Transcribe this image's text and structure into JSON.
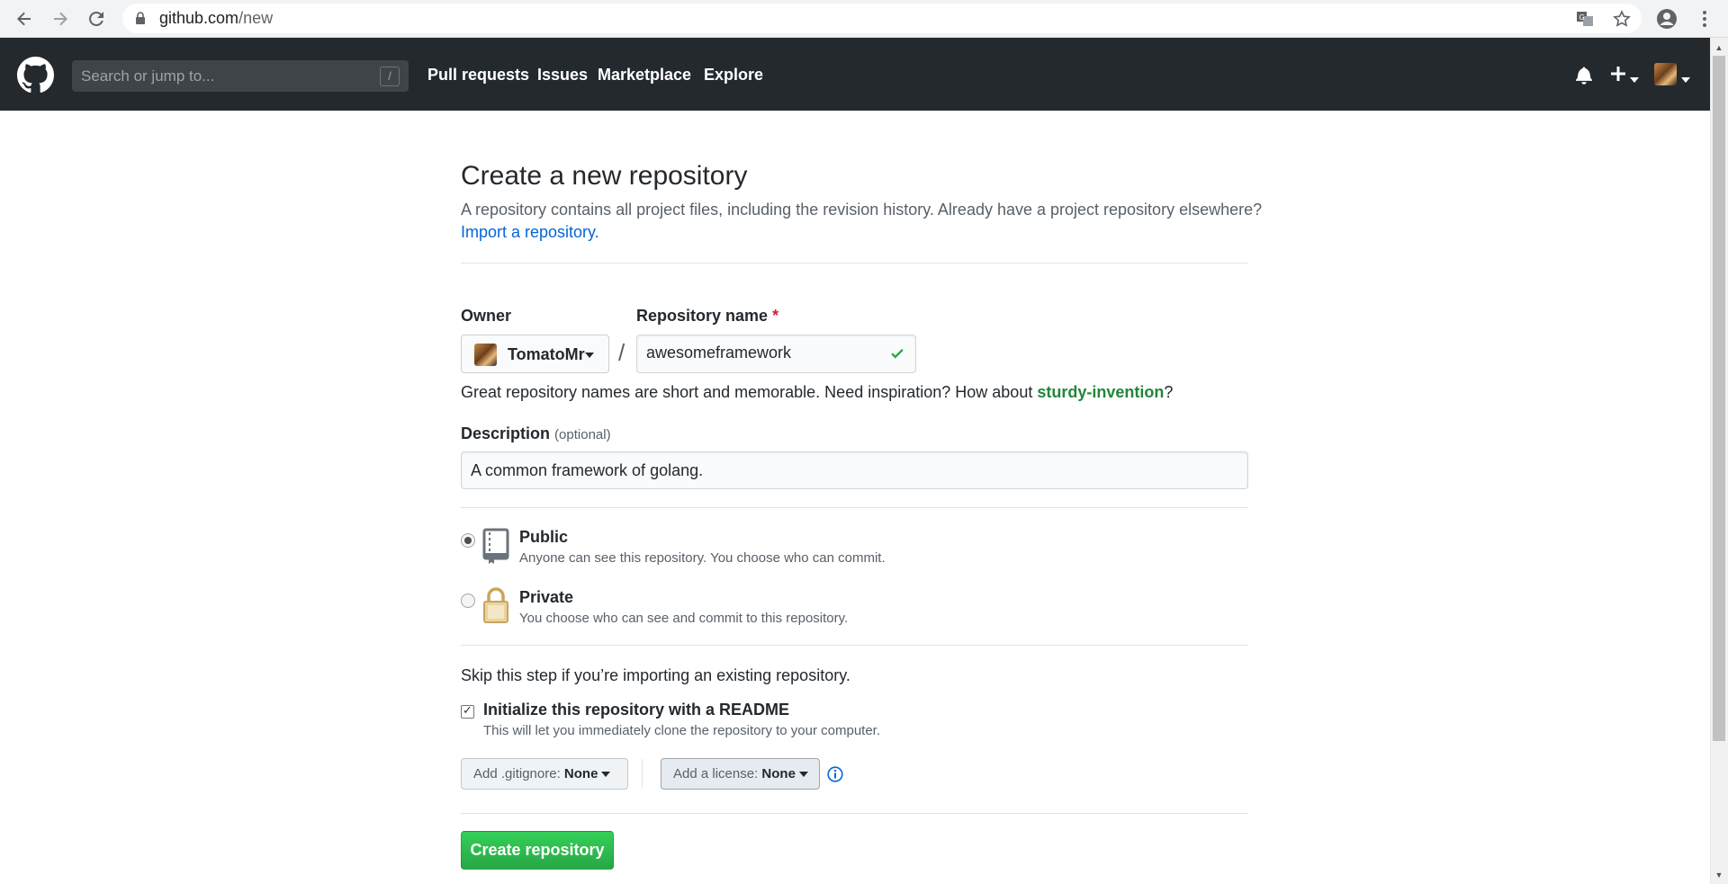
{
  "browser": {
    "url_host": "github.com",
    "url_path": "/new",
    "icons": [
      "back-arrow-icon",
      "forward-arrow-icon",
      "reload-icon",
      "lock-icon",
      "translate-icon",
      "star-icon",
      "profile-icon",
      "menu-dots-icon"
    ]
  },
  "header": {
    "search_placeholder": "Search or jump to...",
    "search_shortcut": "/",
    "nav": [
      "Pull requests",
      "Issues",
      "Marketplace",
      "Explore"
    ]
  },
  "page": {
    "title": "Create a new repository",
    "subtitle": "A repository contains all project files, including the revision history. Already have a project repository elsewhere?",
    "import_link": "Import a repository."
  },
  "form": {
    "owner_label": "Owner",
    "owner_value": "TomatoMr",
    "separator": "/",
    "repo_name_label": "Repository name",
    "required_mark": "*",
    "repo_name_value": "awesomeframework",
    "hint_prefix": "Great repository names are short and memorable. Need inspiration? How about ",
    "hint_suggestion": "sturdy-invention",
    "hint_suffix": "?",
    "description_label": "Description",
    "description_optional": "(optional)",
    "description_value": "A common framework of golang.",
    "visibility": {
      "public_title": "Public",
      "public_note": "Anyone can see this repository. You choose who can commit.",
      "private_title": "Private",
      "private_note": "You choose who can see and commit to this repository.",
      "selected": "Public"
    },
    "skip_note": "Skip this step if you’re importing an existing repository.",
    "readme_title": "Initialize this repository with a README",
    "readme_note": "This will let you immediately clone the repository to your computer.",
    "readme_checked": true,
    "gitignore_label": "Add .gitignore:",
    "gitignore_value": "None",
    "license_label": "Add a license:",
    "license_value": "None",
    "submit_label": "Create repository"
  },
  "colors": {
    "header_bg": "#24292e",
    "link": "#0366d6",
    "suggestion": "#22863a",
    "primary_button": "#28a745",
    "required": "#cb2431"
  }
}
